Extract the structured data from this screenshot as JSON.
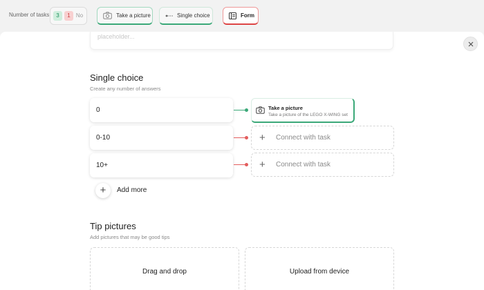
{
  "toolbar": {
    "tasks_label": "Number of tasks",
    "count_green": "3",
    "count_red": "1",
    "count_no": "No",
    "chips": [
      {
        "label": "Take a picture",
        "icon": "camera-icon"
      },
      {
        "label": "Single choice",
        "icon": "connector-icon"
      },
      {
        "label": "Form",
        "icon": "form-icon"
      }
    ]
  },
  "modal": {
    "close_icon": "close-icon",
    "prev_placeholder": "placeholder..."
  },
  "single_choice": {
    "title": "Single choice",
    "subtitle": "Create any number of answers",
    "answers": [
      {
        "value": "0",
        "connected": true
      },
      {
        "value": "0-10",
        "connected": false
      },
      {
        "value": "10+",
        "connected": false
      }
    ],
    "linked_task": {
      "title": "Take a picture",
      "description": "Take a picture of the LEGO X-WING set"
    },
    "connect_label": "Connect with task",
    "add_more_label": "Add more"
  },
  "tip_pictures": {
    "title": "Tip pictures",
    "subtitle": "Add pictures that may be good tips",
    "drag_label": "Drag and drop",
    "upload_label": "Upload from device"
  },
  "colors": {
    "connected": "#3aa878",
    "unconnected": "#e35d5d",
    "accent_red": "#d44444"
  }
}
